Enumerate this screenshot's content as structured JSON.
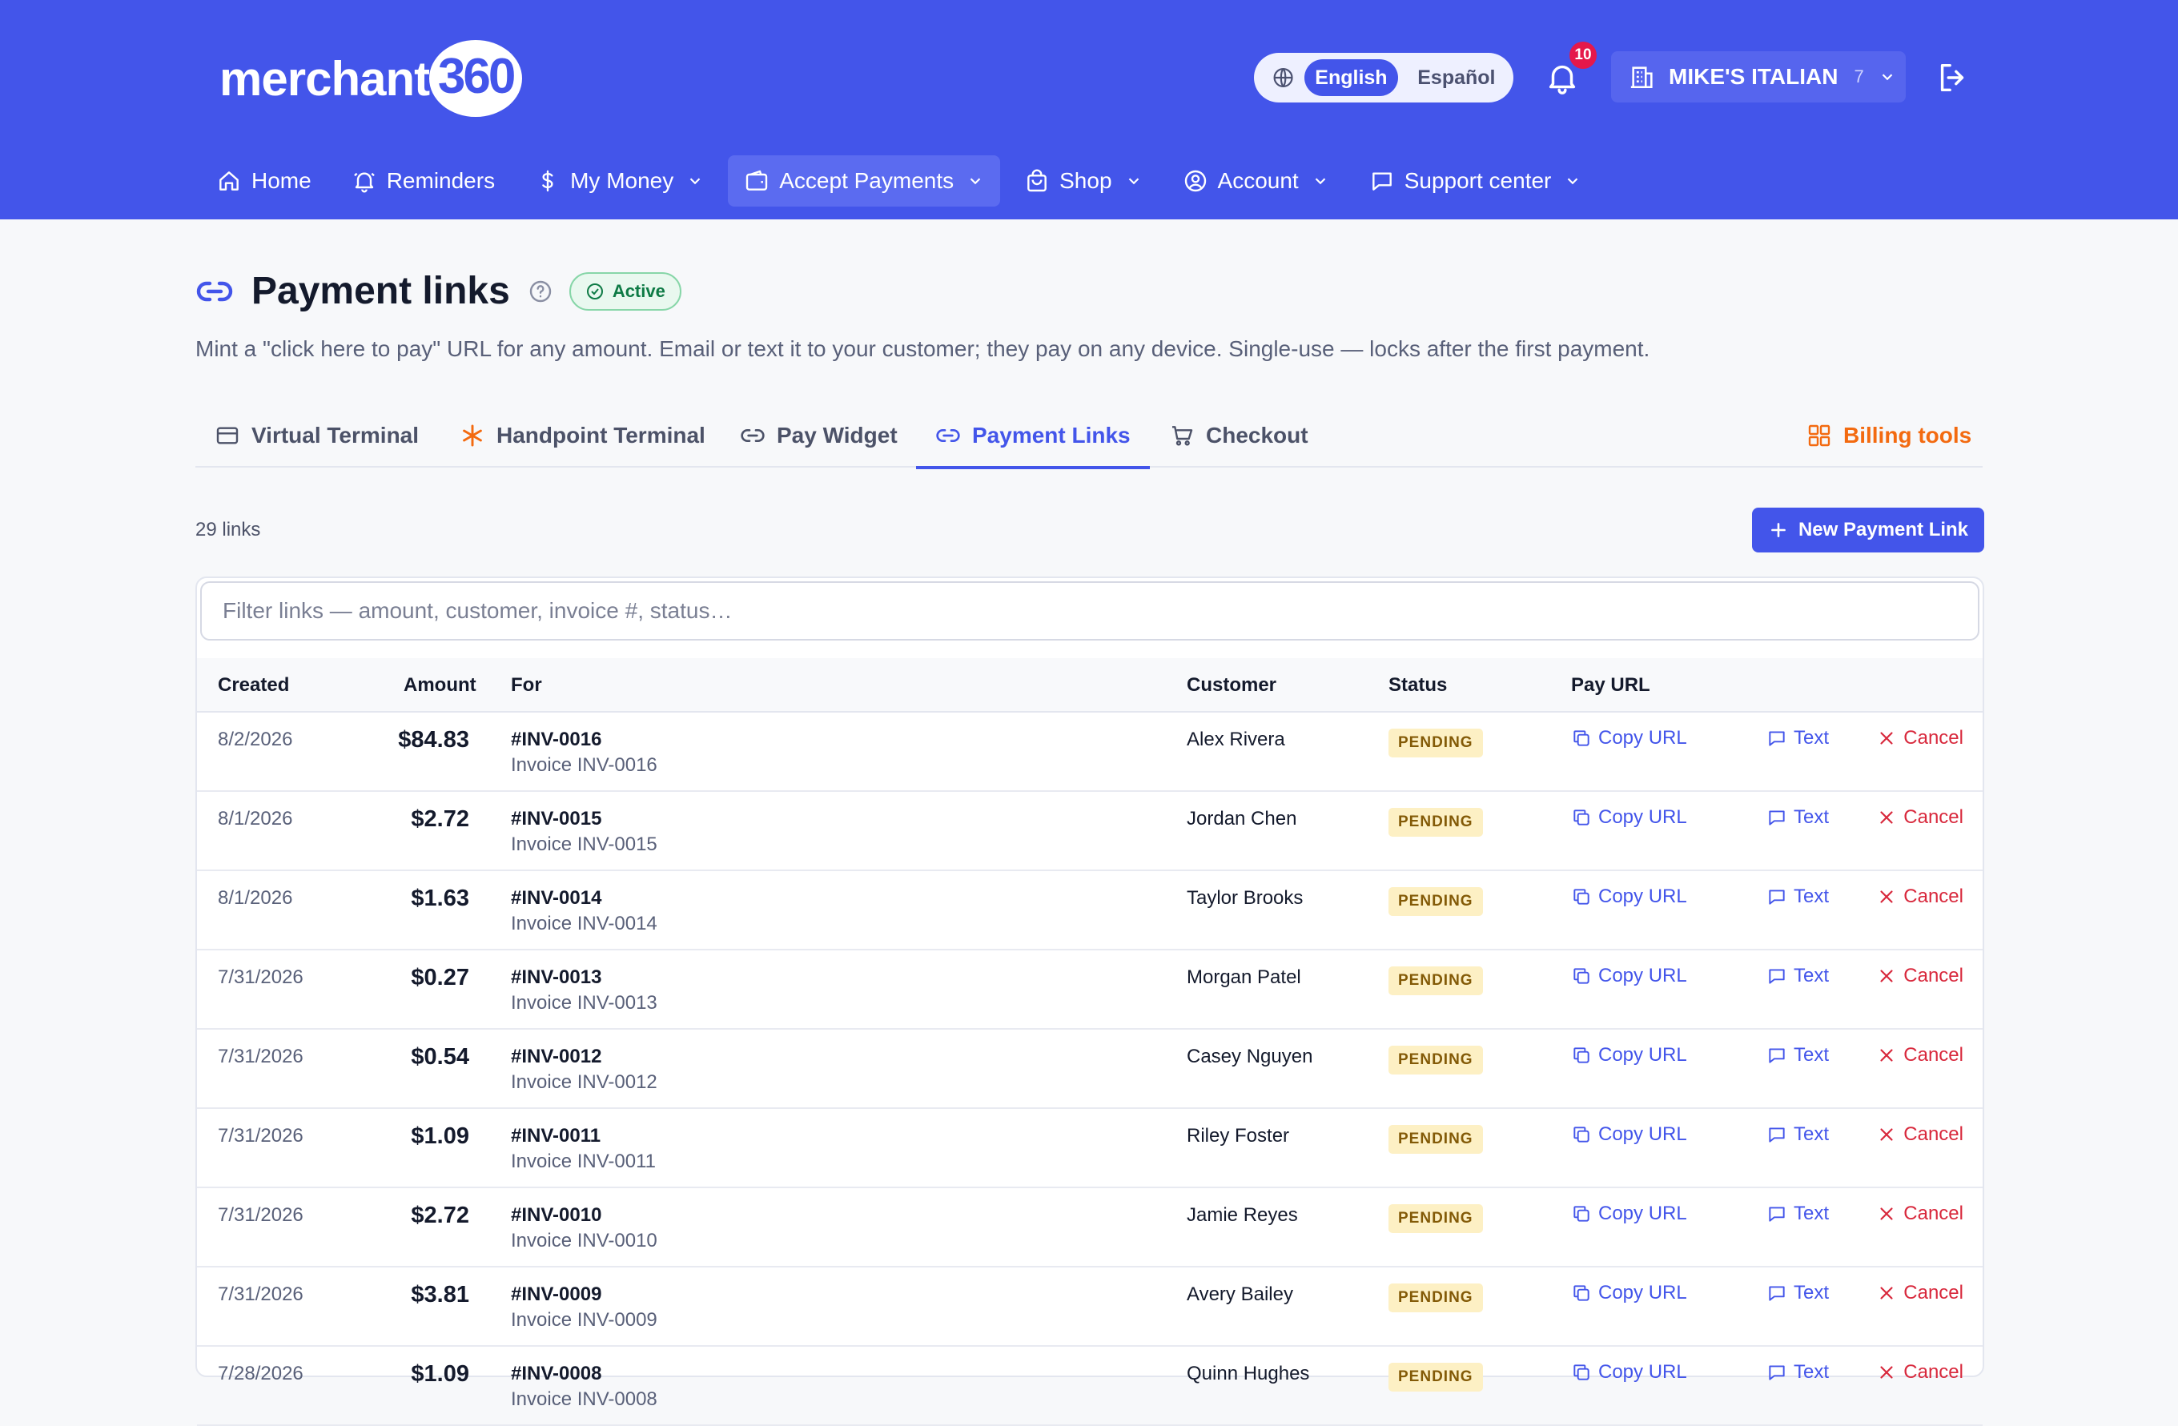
{
  "brand": {
    "logo_text": "merchant",
    "logo_number": "360"
  },
  "language": {
    "selected": "English",
    "other": "Español"
  },
  "notifications": {
    "count": "10"
  },
  "merchant": {
    "name": "MIKE'S ITALIAN",
    "count": "7"
  },
  "nav": [
    {
      "label": "Home",
      "icon": "home-icon"
    },
    {
      "label": "Reminders",
      "icon": "bell-icon"
    },
    {
      "label": "My Money",
      "icon": "dollar-icon"
    },
    {
      "label": "Accept Payments",
      "icon": "wallet-icon"
    },
    {
      "label": "Shop",
      "icon": "shopping-bag-icon"
    },
    {
      "label": "Account",
      "icon": "user-circle-icon"
    },
    {
      "label": "Support center",
      "icon": "chat-icon"
    }
  ],
  "page": {
    "title": "Payment links",
    "status": "Active",
    "subtitle": "Mint a \"click here to pay\" URL for any amount. Email or text it to your customer; they pay on any device. Single-use — locks after the first payment."
  },
  "tabs": [
    {
      "label": "Virtual Terminal",
      "icon": "card-icon"
    },
    {
      "label": "Handpoint Terminal",
      "icon": "asterisk-icon"
    },
    {
      "label": "Pay Widget",
      "icon": "link-icon"
    },
    {
      "label": "Payment Links",
      "icon": "link-icon"
    },
    {
      "label": "Checkout",
      "icon": "cart-icon"
    }
  ],
  "billing_tools": "Billing tools",
  "list": {
    "count_label": "29 links",
    "new_button": "New Payment Link"
  },
  "filter": {
    "placeholder": "Filter links — amount, customer, invoice #, status…"
  },
  "table": {
    "headers": {
      "created": "Created",
      "amount": "Amount",
      "for": "For",
      "customer": "Customer",
      "status": "Status",
      "pay_url": "Pay URL"
    },
    "actions": {
      "copy": "Copy URL",
      "text": "Text",
      "cancel": "Cancel"
    },
    "rows": [
      {
        "created": "8/2/2026",
        "amount": "$84.83",
        "invoice": "#INV-0016",
        "desc": "Invoice INV-0016",
        "customer": "Alex Rivera",
        "status": "PENDING"
      },
      {
        "created": "8/1/2026",
        "amount": "$2.72",
        "invoice": "#INV-0015",
        "desc": "Invoice INV-0015",
        "customer": "Jordan Chen",
        "status": "PENDING"
      },
      {
        "created": "8/1/2026",
        "amount": "$1.63",
        "invoice": "#INV-0014",
        "desc": "Invoice INV-0014",
        "customer": "Taylor Brooks",
        "status": "PENDING"
      },
      {
        "created": "7/31/2026",
        "amount": "$0.27",
        "invoice": "#INV-0013",
        "desc": "Invoice INV-0013",
        "customer": "Morgan Patel",
        "status": "PENDING"
      },
      {
        "created": "7/31/2026",
        "amount": "$0.54",
        "invoice": "#INV-0012",
        "desc": "Invoice INV-0012",
        "customer": "Casey Nguyen",
        "status": "PENDING"
      },
      {
        "created": "7/31/2026",
        "amount": "$1.09",
        "invoice": "#INV-0011",
        "desc": "Invoice INV-0011",
        "customer": "Riley Foster",
        "status": "PENDING"
      },
      {
        "created": "7/31/2026",
        "amount": "$2.72",
        "invoice": "#INV-0010",
        "desc": "Invoice INV-0010",
        "customer": "Jamie Reyes",
        "status": "PENDING"
      },
      {
        "created": "7/31/2026",
        "amount": "$3.81",
        "invoice": "#INV-0009",
        "desc": "Invoice INV-0009",
        "customer": "Avery Bailey",
        "status": "PENDING"
      },
      {
        "created": "7/28/2026",
        "amount": "$1.09",
        "invoice": "#INV-0008",
        "desc": "Invoice INV-0008",
        "customer": "Quinn Hughes",
        "status": "PENDING"
      }
    ]
  },
  "colors": {
    "primary": "#4355ea",
    "orange": "#f36a10",
    "danger": "#d8283c",
    "success": "#0e7a45"
  }
}
